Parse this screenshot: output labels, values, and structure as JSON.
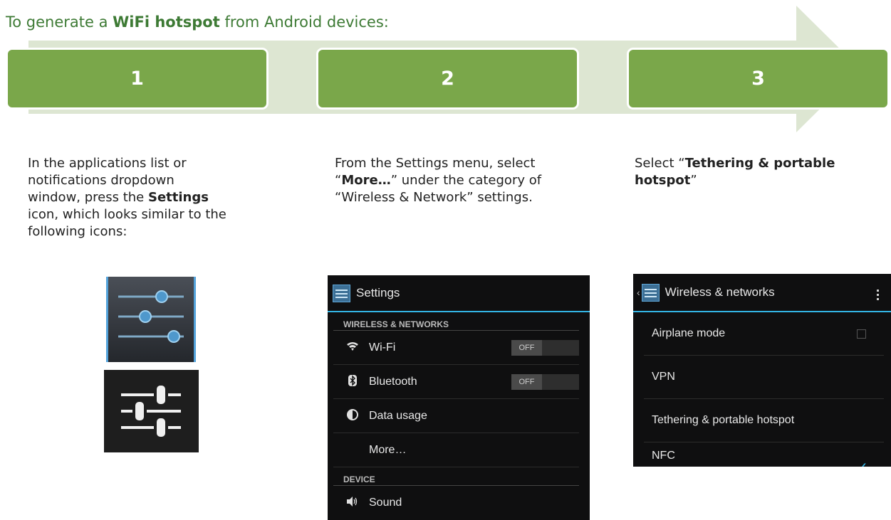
{
  "heading": {
    "prefix": "To generate a ",
    "bold": "WiFi hotspot",
    "suffix": " from Android devices:"
  },
  "colors": {
    "step_fill": "#7aa74a",
    "arrow_fill": "#dde6d2",
    "heading": "#3d7a34",
    "accent": "#33b5e5"
  },
  "steps": [
    {
      "number": "1"
    },
    {
      "number": "2"
    },
    {
      "number": "3"
    }
  ],
  "step1": {
    "line1": "In the applications list or",
    "line2": "notifications dropdown",
    "line3_pre": "window, press the ",
    "line3_bold": "Settings",
    "line4": "icon, which looks similar to the",
    "line5": "following icons:"
  },
  "step2": {
    "line1": "From the Settings menu, select",
    "line2_q1": "“",
    "line2_bold": "More…",
    "line2_rest": "” under the category of",
    "line3": "“Wireless & Network” settings."
  },
  "step3": {
    "line1_pre": "Select “",
    "line1_bold": "Tethering & portable",
    "line2_bold": "hotspot",
    "line2_post": "”"
  },
  "icons": {
    "blue": "settings-sliders-icon",
    "dark": "settings-sliders-icon"
  },
  "screen1": {
    "title": "Settings",
    "section1": "WIRELESS & NETWORKS",
    "wifi": "Wi-Fi",
    "wifi_state": "OFF",
    "bluetooth": "Bluetooth",
    "bluetooth_state": "OFF",
    "data_usage": "Data usage",
    "more": "More…",
    "section2": "DEVICE",
    "sound": "Sound"
  },
  "screen2": {
    "title": "Wireless & networks",
    "airplane": "Airplane mode",
    "vpn": "VPN",
    "tethering": "Tethering & portable hotspot",
    "nfc": "NFC"
  }
}
